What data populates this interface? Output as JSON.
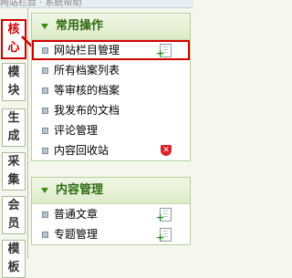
{
  "top_strip": "网站栏目 · 系统帮助",
  "tabs": [
    {
      "chars": [
        "核",
        "心"
      ],
      "active": true
    },
    {
      "chars": [
        "模",
        "块"
      ],
      "active": false
    },
    {
      "chars": [
        "生",
        "成"
      ],
      "active": false
    },
    {
      "chars": [
        "采",
        "集"
      ],
      "active": false
    },
    {
      "chars": [
        "会",
        "员"
      ],
      "active": false
    },
    {
      "chars": [
        "模",
        "板"
      ],
      "active": false
    }
  ],
  "sections": [
    {
      "title": "常用操作",
      "items": [
        {
          "label": "网站栏目管理",
          "icon": "add-document-icon"
        },
        {
          "label": "所有档案列表"
        },
        {
          "label": "等审核的档案"
        },
        {
          "label": "我发布的文档"
        },
        {
          "label": "评论管理"
        },
        {
          "label": "内容回收站",
          "icon": "delete-icon"
        }
      ]
    },
    {
      "title": "内容管理",
      "items": [
        {
          "label": "普通文章",
          "icon": "add-document-icon"
        },
        {
          "label": "专题管理",
          "icon": "add-document-icon"
        }
      ]
    }
  ],
  "colors": {
    "accent_red": "#d00000",
    "header_green": "#2f6b11",
    "panel_bg": "#f4f8ec"
  }
}
